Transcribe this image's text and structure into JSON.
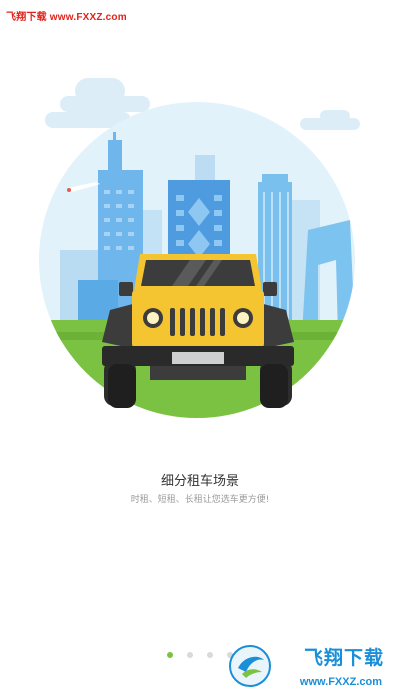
{
  "watermark": {
    "site_text": "飞翔下载 www.FXXZ.com"
  },
  "onboarding": {
    "title": "细分租车场景",
    "subtitle": "时租、短租、长租让您选车更方便!"
  },
  "pagination": {
    "total": 4,
    "active_index": 0
  },
  "logo": {
    "name": "飞翔下载",
    "url": "www.FXXZ.com"
  },
  "colors": {
    "sky": "#dff1fb",
    "grass": "#7cc242",
    "car_body": "#f5c431",
    "accent_dot": "#7cc242",
    "watermark_red": "#e0241b",
    "logo_blue": "#1a8fd8"
  }
}
